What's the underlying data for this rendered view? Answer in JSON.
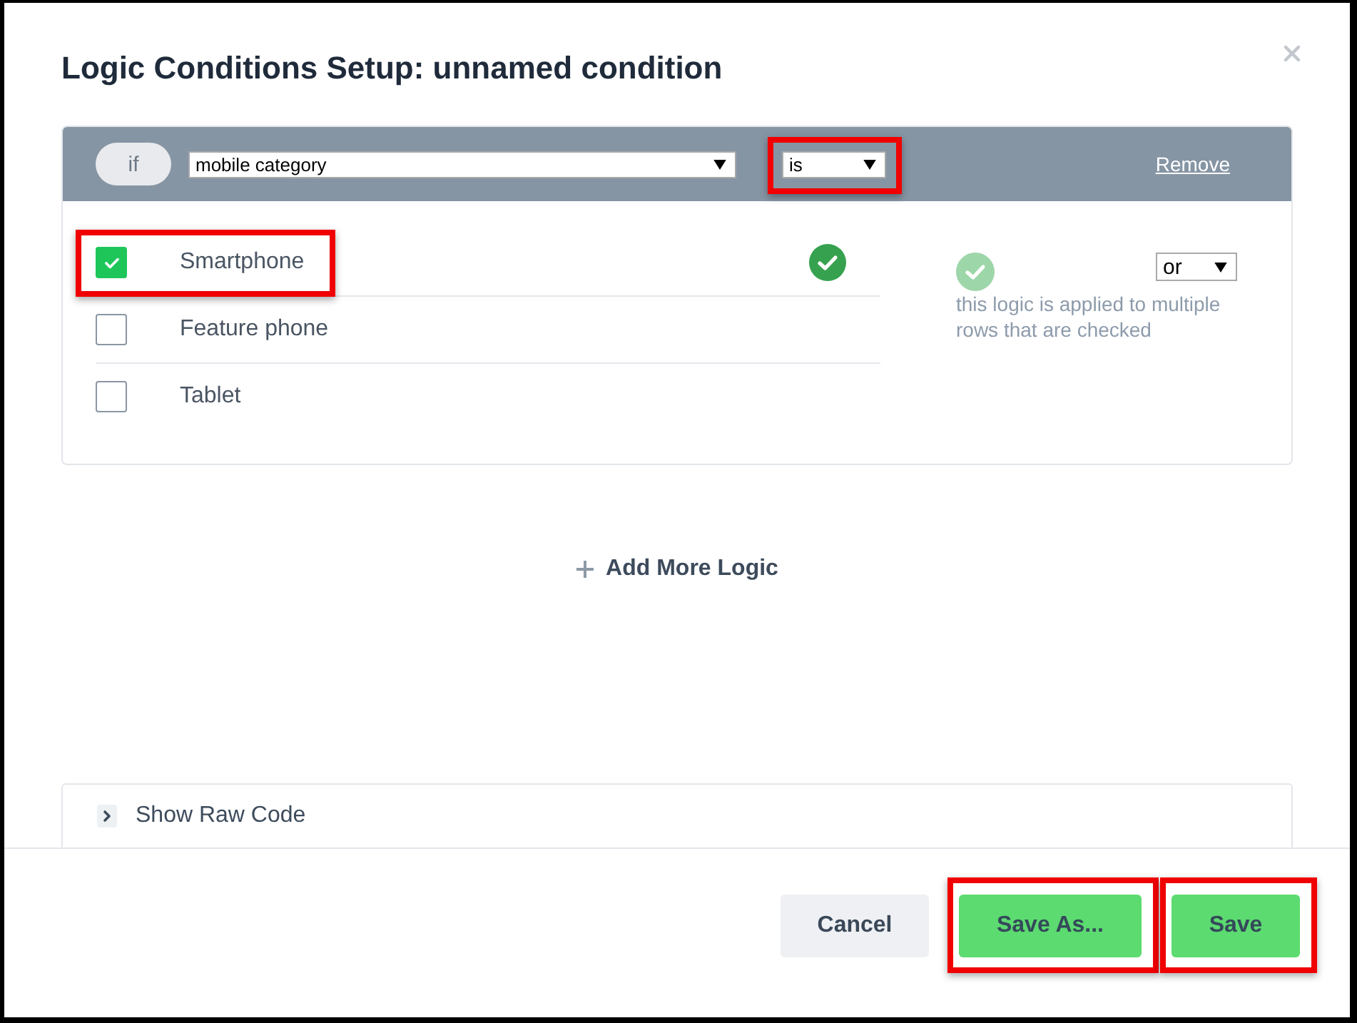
{
  "dialog": {
    "title": "Logic Conditions Setup: unnamed condition"
  },
  "condition": {
    "keyword": "if",
    "field": {
      "value": "mobile category"
    },
    "operator": {
      "value": "is",
      "highlighted": true
    },
    "remove_link": "Remove",
    "options": [
      {
        "label": "Smartphone",
        "checked": true,
        "highlighted": true
      },
      {
        "label": "Feature phone",
        "checked": false,
        "highlighted": false
      },
      {
        "label": "Tablet",
        "checked": false,
        "highlighted": false
      }
    ],
    "combinator": {
      "value": "or"
    },
    "combinator_note": "this logic is applied to multiple rows that are checked"
  },
  "add_logic": "Add More Logic",
  "raw_code": {
    "label": "Show Raw Code",
    "expanded": false
  },
  "buttons": [
    {
      "label": "Cancel",
      "kind": "cancel",
      "highlighted": false
    },
    {
      "label": "Save As...",
      "kind": "save_as",
      "highlighted": true
    },
    {
      "label": "Save",
      "kind": "save",
      "highlighted": true
    }
  ]
}
